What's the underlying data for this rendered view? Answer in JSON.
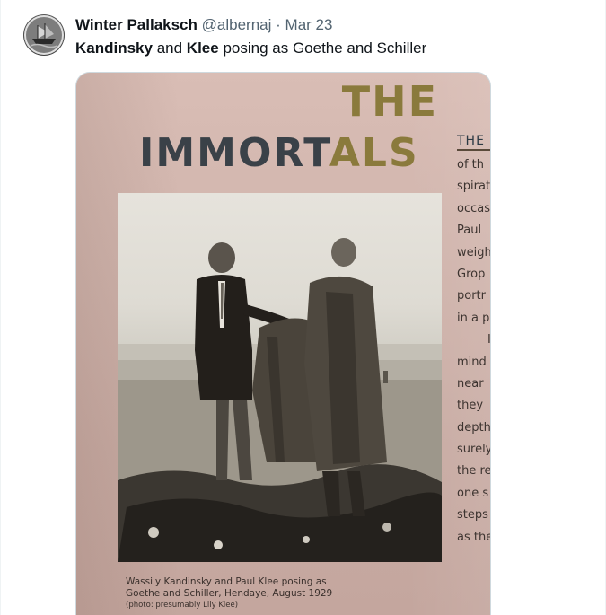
{
  "tweet": {
    "author_name": "Winter Pallaksch",
    "handle": "@albernaj",
    "separator": "·",
    "date": "Mar 23",
    "text_bold_1": "Kandinsky",
    "text_mid": " and ",
    "text_bold_2": "Klee",
    "text_rest": " posing as Goethe and Schiller"
  },
  "media": {
    "title_line1": "THE",
    "title_line2_dark": "IMMORT",
    "title_line2_gold": "ALS",
    "side_heading": "THE",
    "side_lines": [
      "of th",
      "spirat",
      "occas",
      "Paul",
      "weigh",
      "Grop",
      "portr",
      "in a p",
      "I",
      "mind",
      "near",
      "they",
      "depth",
      "surely",
      "the re",
      "one s",
      "steps",
      "as the"
    ],
    "caption_line1": "Wassily Kandinsky and Paul Klee posing as",
    "caption_line2": "Goethe and Schiller, Hendaye, August 1929",
    "caption_line3": "(photo: presumably Lily Klee)"
  },
  "colors": {
    "text_primary": "#0f1419",
    "text_secondary": "#536471",
    "title_gold": "#8a7a3c",
    "title_dark": "#3a4148"
  }
}
